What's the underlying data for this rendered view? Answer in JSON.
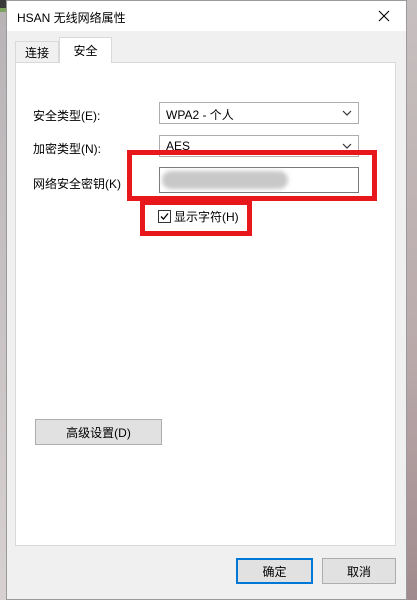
{
  "window": {
    "title": "HSAN 无线网络属性"
  },
  "tabs": [
    {
      "label": "连接"
    },
    {
      "label": "安全"
    }
  ],
  "security": {
    "security_type_label": "安全类型(E):",
    "security_type_value": "WPA2 - 个人",
    "encryption_type_label": "加密类型(N):",
    "encryption_type_value": "AES",
    "key_label": "网络安全密钥(K)",
    "show_chars_label": "显示字符(H)",
    "show_chars_checked": true
  },
  "buttons": {
    "advanced": "高级设置(D)",
    "ok": "确定",
    "cancel": "取消"
  },
  "colors": {
    "highlight_box": "#e8171b",
    "primary_border": "#0078d7"
  }
}
